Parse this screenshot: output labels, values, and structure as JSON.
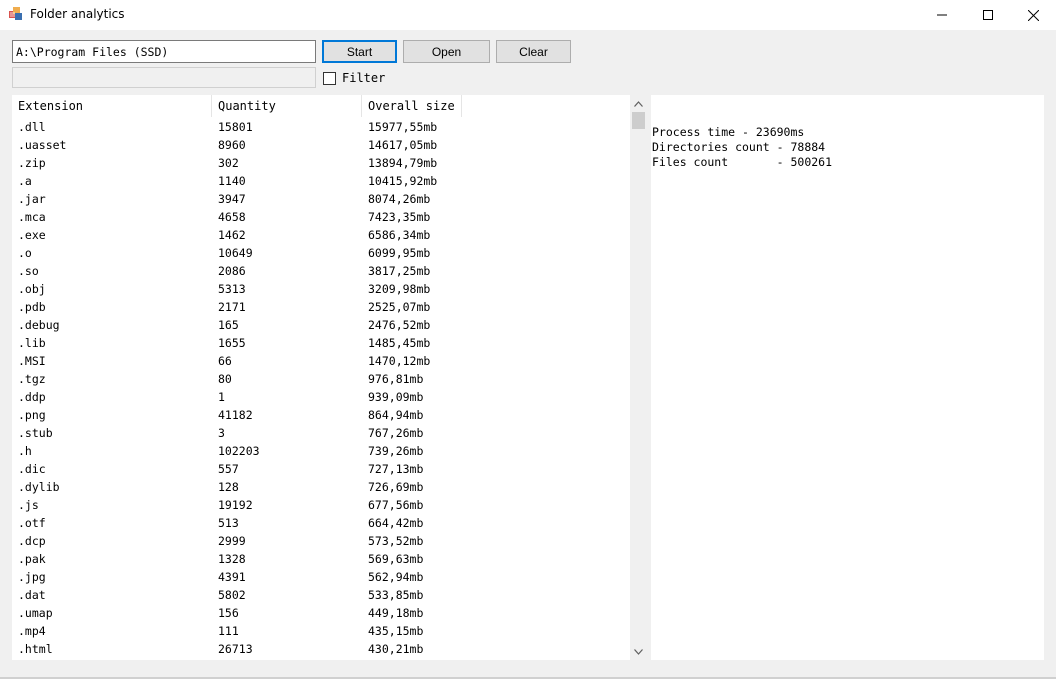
{
  "window": {
    "title": "Folder analytics",
    "icon": "app-window-icon"
  },
  "controls": {
    "path_value": "A:\\Program Files (SSD)",
    "filter_value": "",
    "start_label": "Start",
    "open_label": "Open",
    "clear_label": "Clear",
    "filter_label": "Filter",
    "filter_checked": false
  },
  "table": {
    "columns": [
      "Extension",
      "Quantity",
      "Overall size"
    ],
    "rows": [
      [
        ".dll",
        "15801",
        "15977,55mb"
      ],
      [
        ".uasset",
        "8960",
        "14617,05mb"
      ],
      [
        ".zip",
        "302",
        "13894,79mb"
      ],
      [
        ".a",
        "1140",
        "10415,92mb"
      ],
      [
        ".jar",
        "3947",
        "8074,26mb"
      ],
      [
        ".mca",
        "4658",
        "7423,35mb"
      ],
      [
        ".exe",
        "1462",
        "6586,34mb"
      ],
      [
        ".o",
        "10649",
        "6099,95mb"
      ],
      [
        ".so",
        "2086",
        "3817,25mb"
      ],
      [
        ".obj",
        "5313",
        "3209,98mb"
      ],
      [
        ".pdb",
        "2171",
        "2525,07mb"
      ],
      [
        ".debug",
        "165",
        "2476,52mb"
      ],
      [
        ".lib",
        "1655",
        "1485,45mb"
      ],
      [
        ".MSI",
        "66",
        "1470,12mb"
      ],
      [
        ".tgz",
        "80",
        "976,81mb"
      ],
      [
        ".ddp",
        "1",
        "939,09mb"
      ],
      [
        ".png",
        "41182",
        "864,94mb"
      ],
      [
        ".stub",
        "3",
        "767,26mb"
      ],
      [
        ".h",
        "102203",
        "739,26mb"
      ],
      [
        ".dic",
        "557",
        "727,13mb"
      ],
      [
        ".dylib",
        "128",
        "726,69mb"
      ],
      [
        ".js",
        "19192",
        "677,56mb"
      ],
      [
        ".otf",
        "513",
        "664,42mb"
      ],
      [
        ".dcp",
        "2999",
        "573,52mb"
      ],
      [
        ".pak",
        "1328",
        "569,63mb"
      ],
      [
        ".jpg",
        "4391",
        "562,94mb"
      ],
      [
        ".dat",
        "5802",
        "533,85mb"
      ],
      [
        ".umap",
        "156",
        "449,18mb"
      ],
      [
        ".mp4",
        "111",
        "435,15mb"
      ],
      [
        ".html",
        "26713",
        "430,21mb"
      ]
    ]
  },
  "stats": {
    "lines": [
      "Process time - 23690ms",
      "Directories count - 78884",
      "Files count       - 500261"
    ]
  }
}
